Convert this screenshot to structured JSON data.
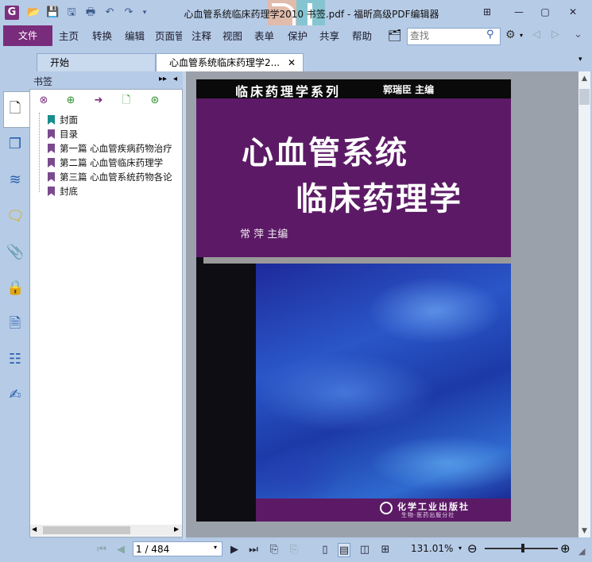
{
  "window": {
    "title": "心血管系统临床药理学2010 书签.pdf - 福昕高级PDF编辑器",
    "app_icon": "G"
  },
  "menu": {
    "file": "文件",
    "items": [
      "主页",
      "转换",
      "编辑",
      "页面管",
      "注释",
      "视图",
      "表单",
      "保护",
      "共享",
      "帮助"
    ],
    "search_placeholder": "查找"
  },
  "tabs": [
    {
      "label": "开始",
      "active": false
    },
    {
      "label": "心血管系统临床药理学2...",
      "active": true
    }
  ],
  "bookmarks": {
    "title": "书签",
    "items": [
      {
        "label": "封面",
        "color": "#1a8c8c"
      },
      {
        "label": "目录",
        "color": "#7b4a8e"
      },
      {
        "label": "第一篇 心血管疾病药物治疗",
        "color": "#7b4a8e"
      },
      {
        "label": "第二篇 心血管临床药理学",
        "color": "#7b4a8e"
      },
      {
        "label": "第三篇 心血管系统药物各论",
        "color": "#7b4a8e"
      },
      {
        "label": "封底",
        "color": "#7b4a8e"
      }
    ]
  },
  "cover": {
    "series": "临床药理学系列",
    "series_editor": "郭瑞臣  主编",
    "title_line1": "心血管系统",
    "title_line2": "临床药理学",
    "editor": "常   萍  主编",
    "publisher": "化学工业出版社",
    "publisher_sub": "生物·医药出版分社"
  },
  "status": {
    "page": "1 / 484",
    "zoom": "131.01%"
  },
  "colors": {
    "chrome": "#b6cbe6",
    "brand_purple": "#7a2c7c",
    "cover_purple": "#5c1a66"
  }
}
